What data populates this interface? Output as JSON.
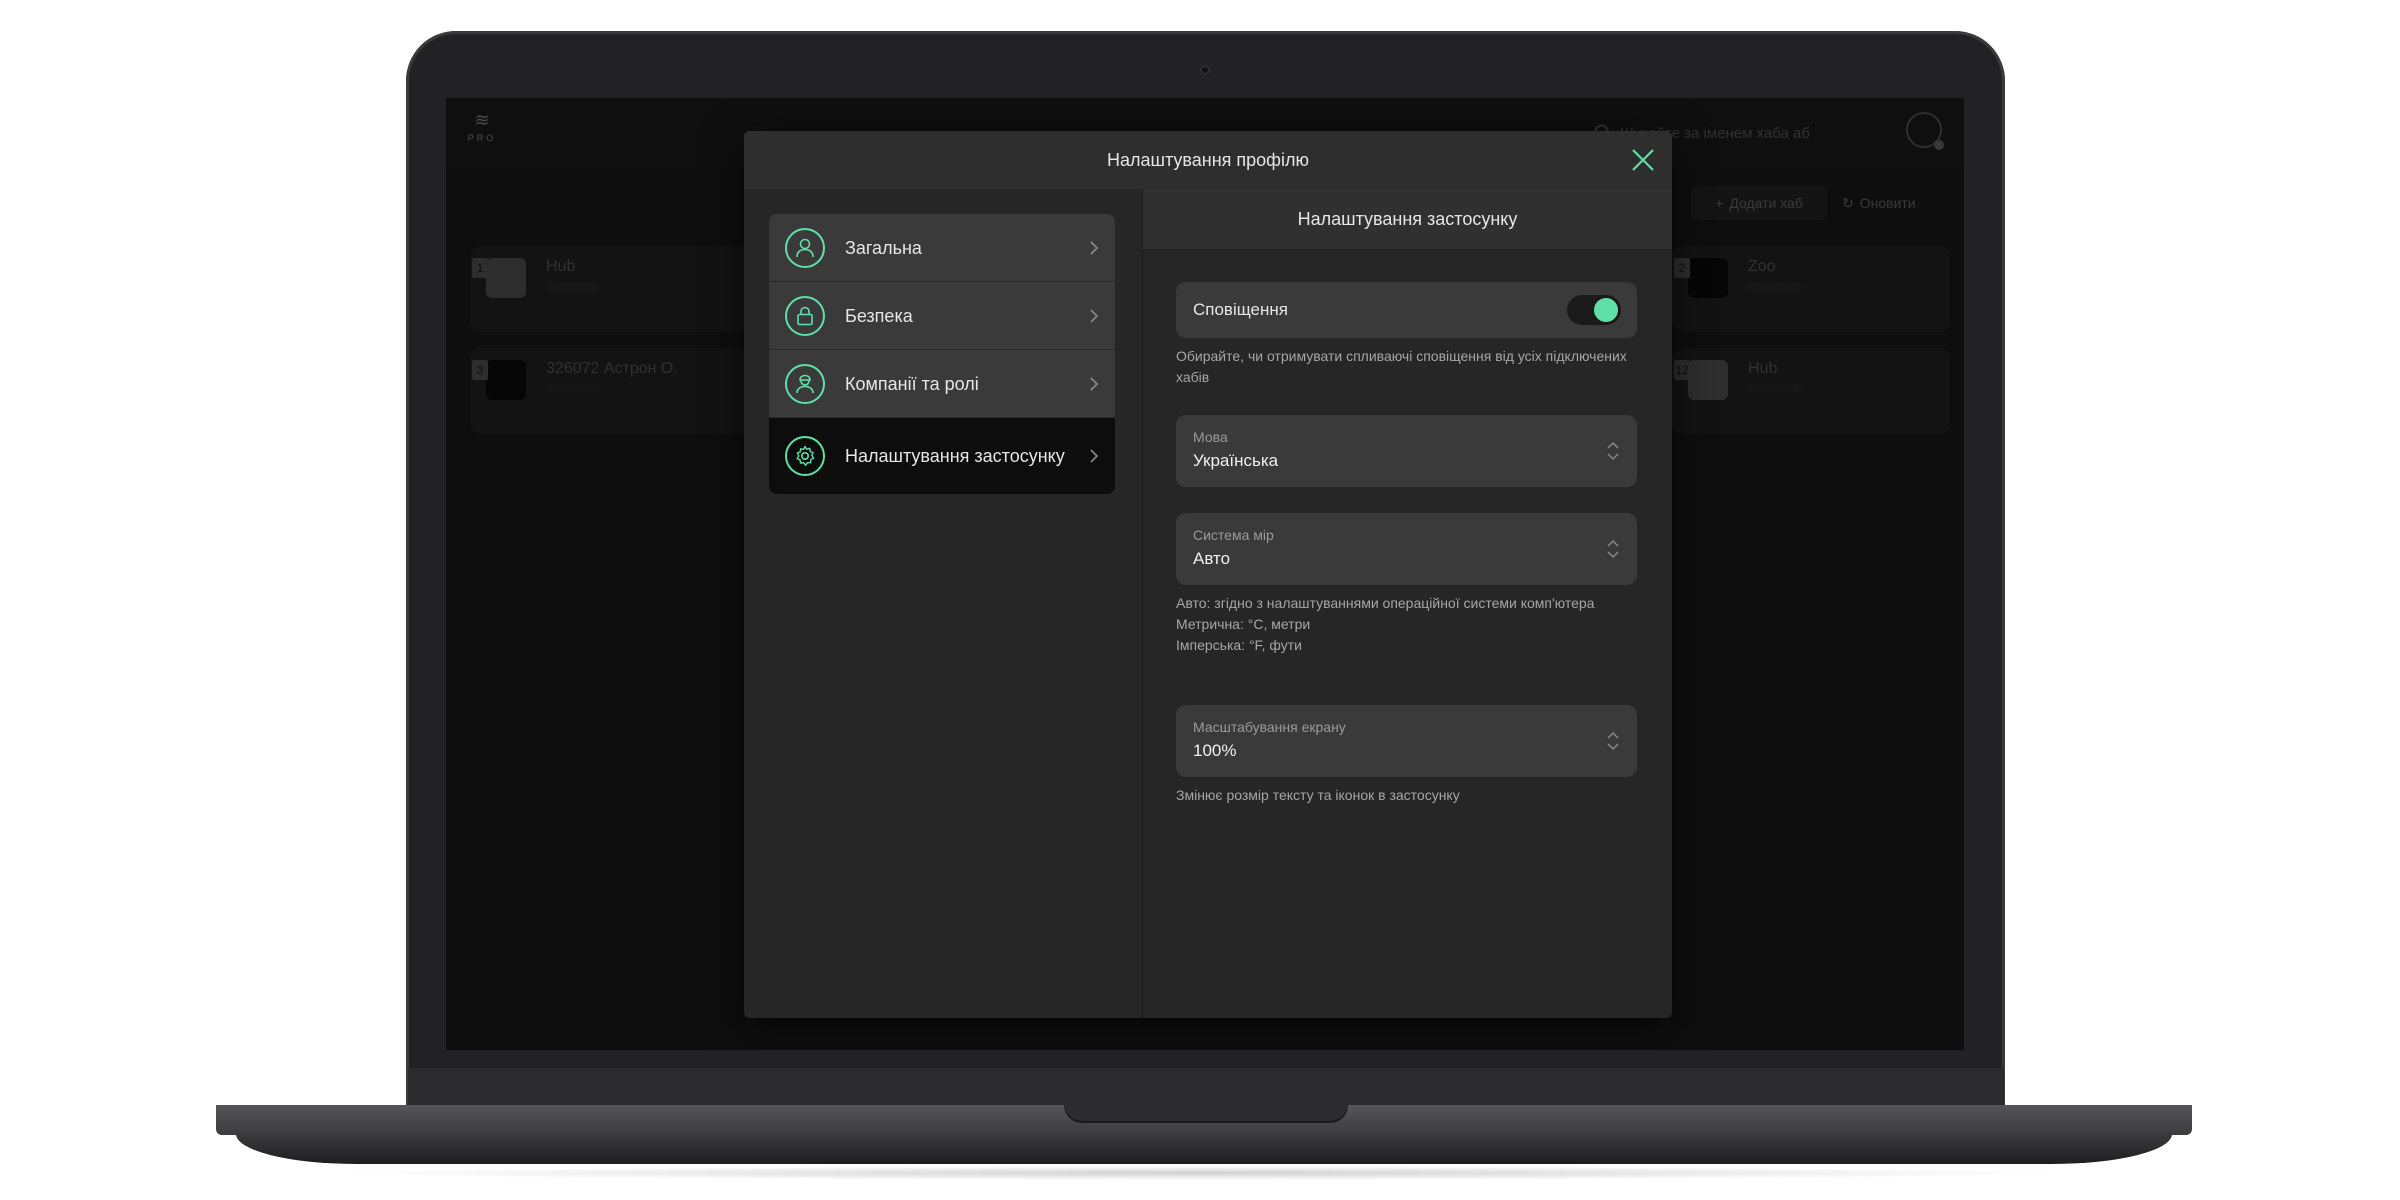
{
  "background_app": {
    "logo": {
      "mark": "≋",
      "sub": "PRO"
    },
    "search_placeholder": "Шукайте за іменем хаба аб",
    "add_hub_label": "Додати хаб",
    "refresh_label": "Оновити",
    "hubs": [
      {
        "num": "1",
        "name": "Hub"
      },
      {
        "num": "3",
        "name": "326072 Астрон О."
      },
      {
        "num": "2",
        "name": "Zoo"
      },
      {
        "num": "12",
        "name": "Hub"
      }
    ]
  },
  "modal": {
    "title": "Налаштування профілю",
    "menu": [
      {
        "label": "Загальна",
        "icon": "user-icon"
      },
      {
        "label": "Безпека",
        "icon": "lock-icon"
      },
      {
        "label": "Компанії та ролі",
        "icon": "installer-icon"
      },
      {
        "label": "Налаштування застосунку",
        "icon": "gear-icon",
        "active": true
      }
    ],
    "app_settings": {
      "title": "Налаштування застосунку",
      "notifications": {
        "label": "Сповіщення",
        "enabled": true,
        "hint": "Обирайте, чи отримувати спливаючі сповіщення від усіх підключених хабів"
      },
      "language": {
        "caption": "Мова",
        "value": "Українська"
      },
      "units": {
        "caption": "Система мір",
        "value": "Авто",
        "hint_lines": [
          "Авто: згідно з налаштуваннями операційної системи комп'ютера",
          "Метрична: °C, метри",
          "Імперська: °F, фути"
        ]
      },
      "scale": {
        "caption": "Масштабування екрану",
        "value": "100%",
        "hint": "Змінює розмір тексту та іконок в застосунку"
      }
    }
  },
  "colors": {
    "accent": "#5fe0a8",
    "panel": "#262626",
    "field": "#3a3a3a"
  }
}
